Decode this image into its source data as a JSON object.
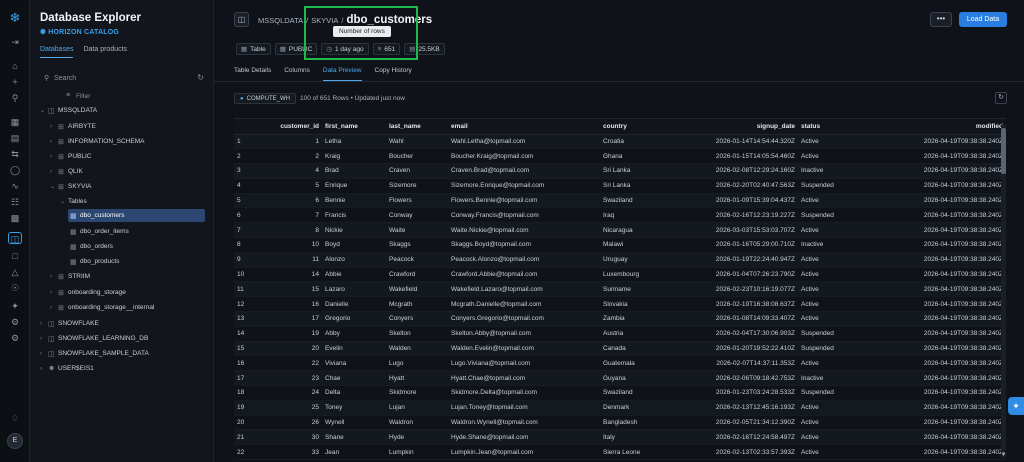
{
  "sidebar": {
    "title": "Database Explorer",
    "subtitle": "HORIZON CATALOG",
    "tabs": [
      "Databases",
      "Data products"
    ],
    "search_placeholder": "Search",
    "filter_label": "Filter",
    "tree": [
      {
        "label": "MSSQLDATA"
      },
      {
        "label": "AIRBYTE"
      },
      {
        "label": "INFORMATION_SCHEMA"
      },
      {
        "label": "PUBLIC"
      },
      {
        "label": "QLIK"
      },
      {
        "label": "SKYVIA"
      },
      {
        "label": "Tables"
      },
      {
        "label": "dbo_customers"
      },
      {
        "label": "dbo_order_items"
      },
      {
        "label": "dbo_orders"
      },
      {
        "label": "dbo_products"
      },
      {
        "label": "STRIIM"
      },
      {
        "label": "onboarding_storage"
      },
      {
        "label": "onboarding_storage__internal"
      },
      {
        "label": "SNOWFLAKE"
      },
      {
        "label": "SNOWFLAKE_LEARNING_DB"
      },
      {
        "label": "SNOWFLAKE_SAMPLE_DATA"
      },
      {
        "label": "USER$EIS1"
      }
    ]
  },
  "rail": {
    "avatar_initial": "E"
  },
  "header": {
    "breadcrumb": [
      "MSSQLDATA",
      "/",
      "SKYVIA",
      "/"
    ],
    "title": "dbo_customers",
    "tooltip": "Number of rows",
    "chips": [
      "Table",
      "PUBLIC",
      "1 day ago",
      "651",
      "25.5KB"
    ],
    "more_label": "•••",
    "load_button": "Load Data"
  },
  "tabs": [
    "Table Details",
    "Columns",
    "Data Preview",
    "Copy History"
  ],
  "active_tab": "Data Preview",
  "preview": {
    "warehouse": "COMPUTE_WH",
    "rows_info": "100 of 651 Rows • Updated just now"
  },
  "table": {
    "columns": [
      "",
      "customer_id",
      "first_name",
      "last_name",
      "email",
      "country",
      "signup_date",
      "status",
      "modified"
    ],
    "rows": [
      [
        "1",
        "1",
        "Letha",
        "Wahl",
        "Wahl.Letha@topmail.com",
        "Croatia",
        "2026-01-14T14:54:44.320Z",
        "Active",
        "2026-04-19T09:38:38.240Z"
      ],
      [
        "2",
        "2",
        "Kraig",
        "Boucher",
        "Boucher.Kraig@topmail.com",
        "Ghana",
        "2026-01-15T14:05:54.460Z",
        "Active",
        "2026-04-19T09:38:38.240Z"
      ],
      [
        "3",
        "4",
        "Brad",
        "Craven",
        "Craven.Brad@topmail.com",
        "Sri Lanka",
        "2026-02-08T12:29:24.160Z",
        "Inactive",
        "2026-04-19T09:38:38.240Z"
      ],
      [
        "4",
        "5",
        "Enrique",
        "Sizemore",
        "Sizemore.Enrique@topmail.com",
        "Sri Lanka",
        "2026-02-20T02:40:47.563Z",
        "Suspended",
        "2026-04-19T09:38:38.240Z"
      ],
      [
        "5",
        "6",
        "Bennie",
        "Flowers",
        "Flowers.Bennie@topmail.com",
        "Swaziland",
        "2026-01-09T15:39:04.437Z",
        "Active",
        "2026-04-19T09:38:38.240Z"
      ],
      [
        "6",
        "7",
        "Francis",
        "Conway",
        "Conway.Francis@topmail.com",
        "Iraq",
        "2026-02-16T12:23:19.227Z",
        "Suspended",
        "2026-04-19T09:38:38.240Z"
      ],
      [
        "7",
        "8",
        "Nickie",
        "Waite",
        "Waite.Nickie@topmail.com",
        "Nicaragua",
        "2026-03-03T15:53:03.707Z",
        "Active",
        "2026-04-19T09:38:38.240Z"
      ],
      [
        "8",
        "10",
        "Boyd",
        "Skaggs",
        "Skaggs.Boyd@topmail.com",
        "Malawi",
        "2026-01-16T05:29:00.710Z",
        "Inactive",
        "2026-04-19T09:38:38.240Z"
      ],
      [
        "9",
        "11",
        "Alonzo",
        "Peacock",
        "Peacock.Alonzo@topmail.com",
        "Uruguay",
        "2026-01-19T22:24:40.947Z",
        "Active",
        "2026-04-19T09:38:38.240Z"
      ],
      [
        "10",
        "14",
        "Abbie",
        "Crawford",
        "Crawford.Abbie@topmail.com",
        "Luxembourg",
        "2026-01-04T07:26:23.790Z",
        "Active",
        "2026-04-19T09:38:38.240Z"
      ],
      [
        "11",
        "15",
        "Lazaro",
        "Wakefield",
        "Wakefield.Lazaro@topmail.com",
        "Suriname",
        "2026-02-23T10:16:19.077Z",
        "Active",
        "2026-04-19T09:38:38.240Z"
      ],
      [
        "12",
        "16",
        "Danielle",
        "Mcgrath",
        "Mcgrath.Danielle@topmail.com",
        "Slovakia",
        "2026-02-19T16:38:08.637Z",
        "Active",
        "2026-04-19T09:38:38.240Z"
      ],
      [
        "13",
        "17",
        "Gregorio",
        "Conyers",
        "Conyers.Gregorio@topmail.com",
        "Zambia",
        "2026-01-08T14:09:33.407Z",
        "Active",
        "2026-04-19T09:38:38.240Z"
      ],
      [
        "14",
        "19",
        "Abby",
        "Skelton",
        "Skelton.Abby@topmail.com",
        "Austria",
        "2026-02-04T17:30:06.903Z",
        "Suspended",
        "2026-04-19T09:38:38.240Z"
      ],
      [
        "15",
        "20",
        "Evelin",
        "Walden",
        "Walden.Evelin@topmail.com",
        "Canada",
        "2026-01-20T19:52:22.410Z",
        "Suspended",
        "2026-04-19T09:38:38.240Z"
      ],
      [
        "16",
        "22",
        "Viviana",
        "Lugo",
        "Lugo.Viviana@topmail.com",
        "Guatemala",
        "2026-02-07T14:37:11.353Z",
        "Active",
        "2026-04-19T09:38:38.240Z"
      ],
      [
        "17",
        "23",
        "Chae",
        "Hyatt",
        "Hyatt.Chae@topmail.com",
        "Guyana",
        "2026-02-06T09:18:42.753Z",
        "Inactive",
        "2026-04-19T09:38:38.240Z"
      ],
      [
        "18",
        "24",
        "Delta",
        "Skidmore",
        "Skidmore.Delta@topmail.com",
        "Swaziland",
        "2026-01-23T03:24:28.533Z",
        "Suspended",
        "2026-04-19T09:38:38.240Z"
      ],
      [
        "19",
        "25",
        "Toney",
        "Lujan",
        "Lujan.Toney@topmail.com",
        "Denmark",
        "2026-02-13T12:45:16.193Z",
        "Active",
        "2026-04-19T09:38:38.240Z"
      ],
      [
        "20",
        "26",
        "Wynell",
        "Waldron",
        "Waldron.Wynell@topmail.com",
        "Bangladesh",
        "2026-02-05T21:34:12.390Z",
        "Active",
        "2026-04-19T09:38:38.240Z"
      ],
      [
        "21",
        "30",
        "Shane",
        "Hyde",
        "Hyde.Shane@topmail.com",
        "Italy",
        "2026-02-16T12:24:58.497Z",
        "Active",
        "2026-04-19T09:38:38.240Z"
      ],
      [
        "22",
        "33",
        "Jean",
        "Lumpkin",
        "Lumpkin.Jean@topmail.com",
        "Sierra Leone",
        "2026-02-13T02:33:57.393Z",
        "Active",
        "2026-04-19T09:38:38.240Z"
      ]
    ]
  },
  "colors": {
    "accent": "#2a7de1",
    "highlight": "#1fb84a",
    "selected_row": "#2b4670"
  }
}
